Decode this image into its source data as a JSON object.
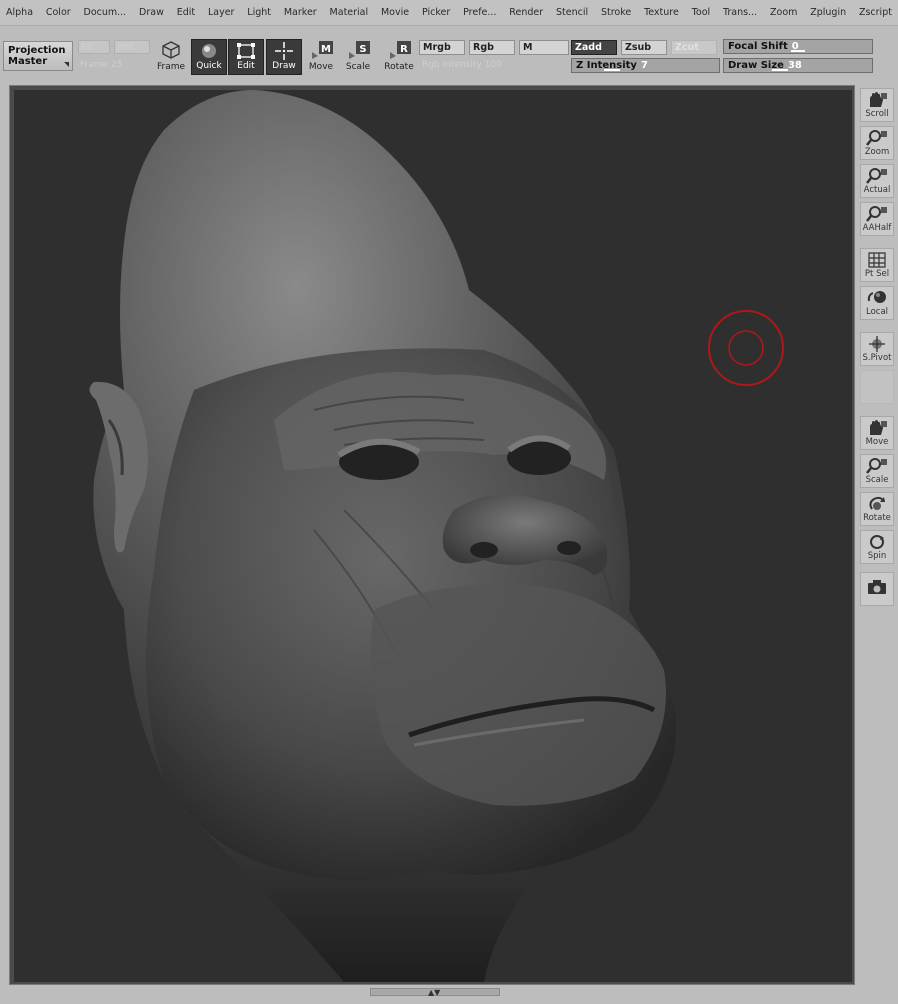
{
  "menu": [
    "Alpha",
    "Color",
    "Docum...",
    "Draw",
    "Edit",
    "Layer",
    "Light",
    "Marker",
    "Material",
    "Movie",
    "Picker",
    "Prefe...",
    "Render",
    "Stencil",
    "Stroke",
    "Texture",
    "Tool",
    "Trans...",
    "Zoom",
    "Zplugin",
    "Zscript"
  ],
  "shelf": {
    "projection_master": "Projection Master",
    "dim_labels": {
      "box1": "Fill",
      "box2": "Pfill",
      "frame_text": "Frame 25",
      "rgb_intensity": "Rgb Intensity 100"
    },
    "tools": {
      "frame": "Frame",
      "quick": "Quick",
      "edit": "Edit",
      "draw": "Draw",
      "move": "Move",
      "scale": "Scale",
      "rotate": "Rotate"
    },
    "modes": {
      "mrgb": "Mrgb",
      "rgb": "Rgb",
      "m": "M",
      "zadd": "Zadd",
      "zsub": "Zsub",
      "zcut": "Zcut"
    },
    "sliders": {
      "focal_shift": {
        "label": "Focal Shift",
        "value": "0"
      },
      "z_intensity": {
        "label": "Z Intensity",
        "value": "7"
      },
      "draw_size": {
        "label": "Draw Size",
        "value": "38"
      }
    }
  },
  "right_shelf": {
    "scroll": "Scroll",
    "zoom": "Zoom",
    "actual": "Actual",
    "aahalf": "AAHalf",
    "ptsel": "Pt Sel",
    "local": "Local",
    "spivot": "S.Pivot",
    "move": "Move",
    "scale": "Scale",
    "rotate": "Rotate",
    "spin": "Spin"
  },
  "colors": {
    "canvas_bg": "#2f2f2f",
    "ui_bg": "#bdbdbd",
    "active_btn": "#3a3a3a",
    "brush_cursor": "#b01818"
  },
  "icons": [
    "frame-icon",
    "quick-sketch-icon",
    "edit-icon",
    "draw-icon",
    "move-m-icon",
    "scale-s-icon",
    "rotate-r-icon",
    "scroll-hand-icon",
    "zoom-magnifier-icon",
    "actual-magnifier-icon",
    "aahalf-magnifier-icon",
    "ptsel-grid-icon",
    "local-icon",
    "spivot-icon",
    "move-hand-icon",
    "scale-magnifier-icon",
    "rotate-icon",
    "spin-icon",
    "camera-icon"
  ]
}
